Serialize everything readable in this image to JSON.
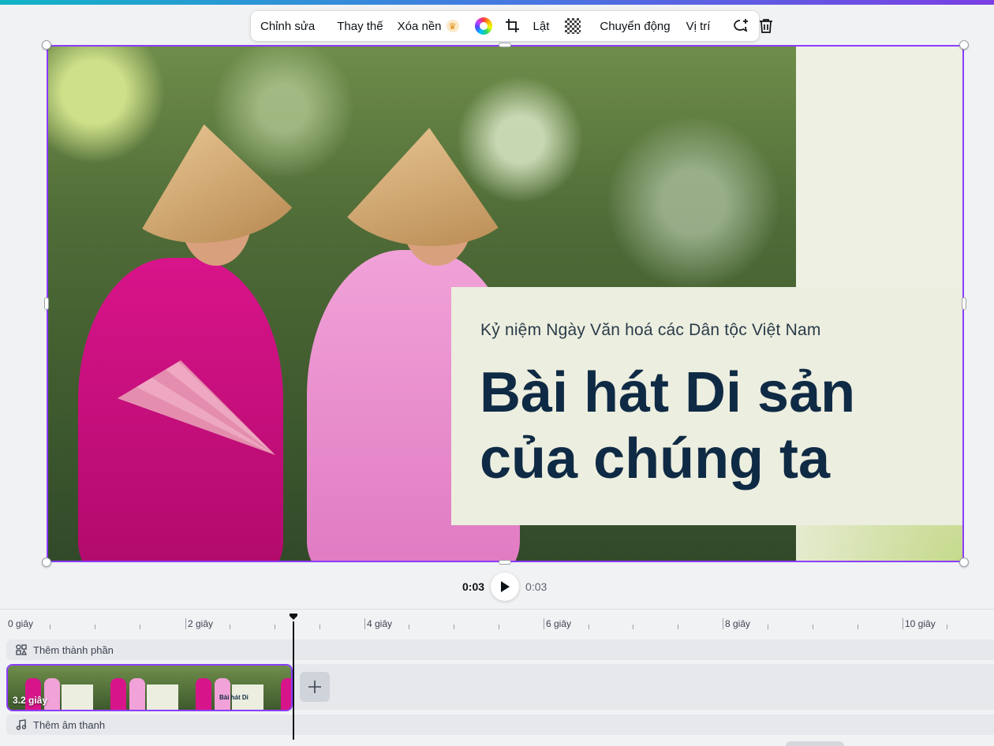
{
  "toolbar": {
    "edit_label": "Chỉnh sửa",
    "replace_label": "Thay thế",
    "remove_bg_label": "Xóa nền",
    "flip_label": "Lật",
    "animate_label": "Chuyển động",
    "position_label": "Vị trí"
  },
  "design": {
    "subtitle": "Kỷ niệm Ngày Văn hoá các Dân tộc Việt Nam",
    "headline": "Bài hát Di sản của chúng ta"
  },
  "playback": {
    "current_time": "0:03",
    "total_time": "0:03"
  },
  "timeline": {
    "ticks": [
      "0 giây",
      "2 giây",
      "4 giây",
      "6 giây",
      "8 giây",
      "10 giây"
    ],
    "add_element_label": "Thêm thành phần",
    "add_audio_label": "Thêm âm thanh",
    "clip_duration": "3.2 giây",
    "thumb_text": "Bài hát Di"
  },
  "colors": {
    "accent": "#8b3dff",
    "headline": "#0f2a44",
    "card_bg": "#eceedf"
  }
}
